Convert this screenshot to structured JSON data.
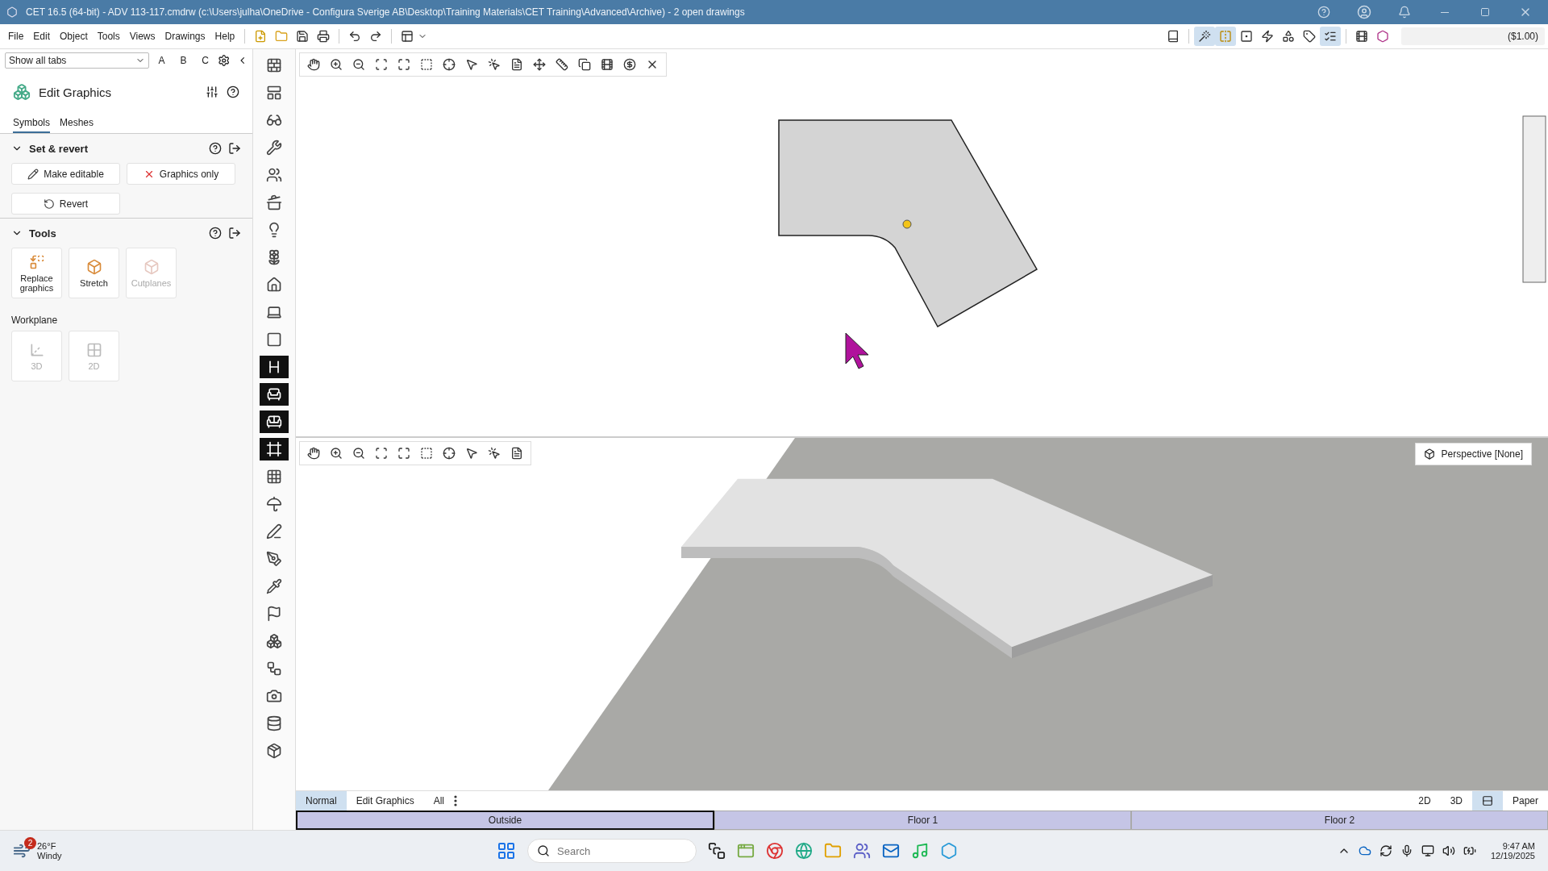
{
  "window": {
    "title": "CET 16.5 (64-bit) - ADV 113-117.cmdrw (c:\\Users\\julha\\OneDrive - Configura Sverige AB\\Desktop\\Training Materials\\CET Training\\Advanced\\Archive) - 2  open drawings"
  },
  "menu": [
    "File",
    "Edit",
    "Object",
    "Tools",
    "Views",
    "Drawings",
    "Help"
  ],
  "price": "($1.00)",
  "tab_filter": {
    "value": "Show all tabs",
    "letters": [
      "A",
      "B",
      "C"
    ]
  },
  "panel": {
    "title": "Edit Graphics",
    "tabs": [
      {
        "label": "Symbols",
        "selected": true
      },
      {
        "label": "Meshes",
        "selected": false
      }
    ],
    "sections": [
      {
        "title": "Set & revert",
        "expanded": true,
        "buttons": [
          {
            "kind": "pencil",
            "label": "Make editable"
          },
          {
            "kind": "cross",
            "label": "Graphics only"
          },
          {
            "kind": "undo",
            "label": "Revert"
          }
        ]
      },
      {
        "title": "Tools",
        "expanded": true,
        "tools": [
          {
            "kind": "replace",
            "label": "Replace graphics",
            "disabled": false
          },
          {
            "kind": "stretch",
            "label": "Stretch",
            "disabled": false
          },
          {
            "kind": "cut",
            "label": "Cutplanes",
            "disabled": true
          }
        ]
      }
    ],
    "workplane": {
      "label": "Workplane",
      "tools": [
        {
          "kind": "spatial",
          "label": "3D",
          "disabled": true
        },
        {
          "kind": "planar",
          "label": "2D",
          "disabled": true
        }
      ]
    }
  },
  "view3d": {
    "camera": "Perspective [None]"
  },
  "view_tabs": [
    {
      "label": "Normal",
      "selected": true
    },
    {
      "label": "Edit Graphics",
      "selected": false
    },
    {
      "label": "All",
      "selected": false
    }
  ],
  "view_modes": [
    {
      "kind": "text",
      "label": "2D",
      "selected": false
    },
    {
      "kind": "text",
      "label": "3D",
      "selected": false
    },
    {
      "kind": "icon",
      "selected": true
    },
    {
      "kind": "text",
      "label": "Paper",
      "selected": false
    }
  ],
  "floors": [
    {
      "label": "Outside",
      "selected": true
    },
    {
      "label": "Floor 1",
      "selected": false
    },
    {
      "label": "Floor 2",
      "selected": false
    }
  ],
  "taskbar": {
    "weather_badge": "2",
    "temperature": "26°F",
    "condition": "Windy",
    "search": {
      "placeholder": "Search"
    },
    "time": "9:47 AM",
    "date": "12/19/2025"
  }
}
